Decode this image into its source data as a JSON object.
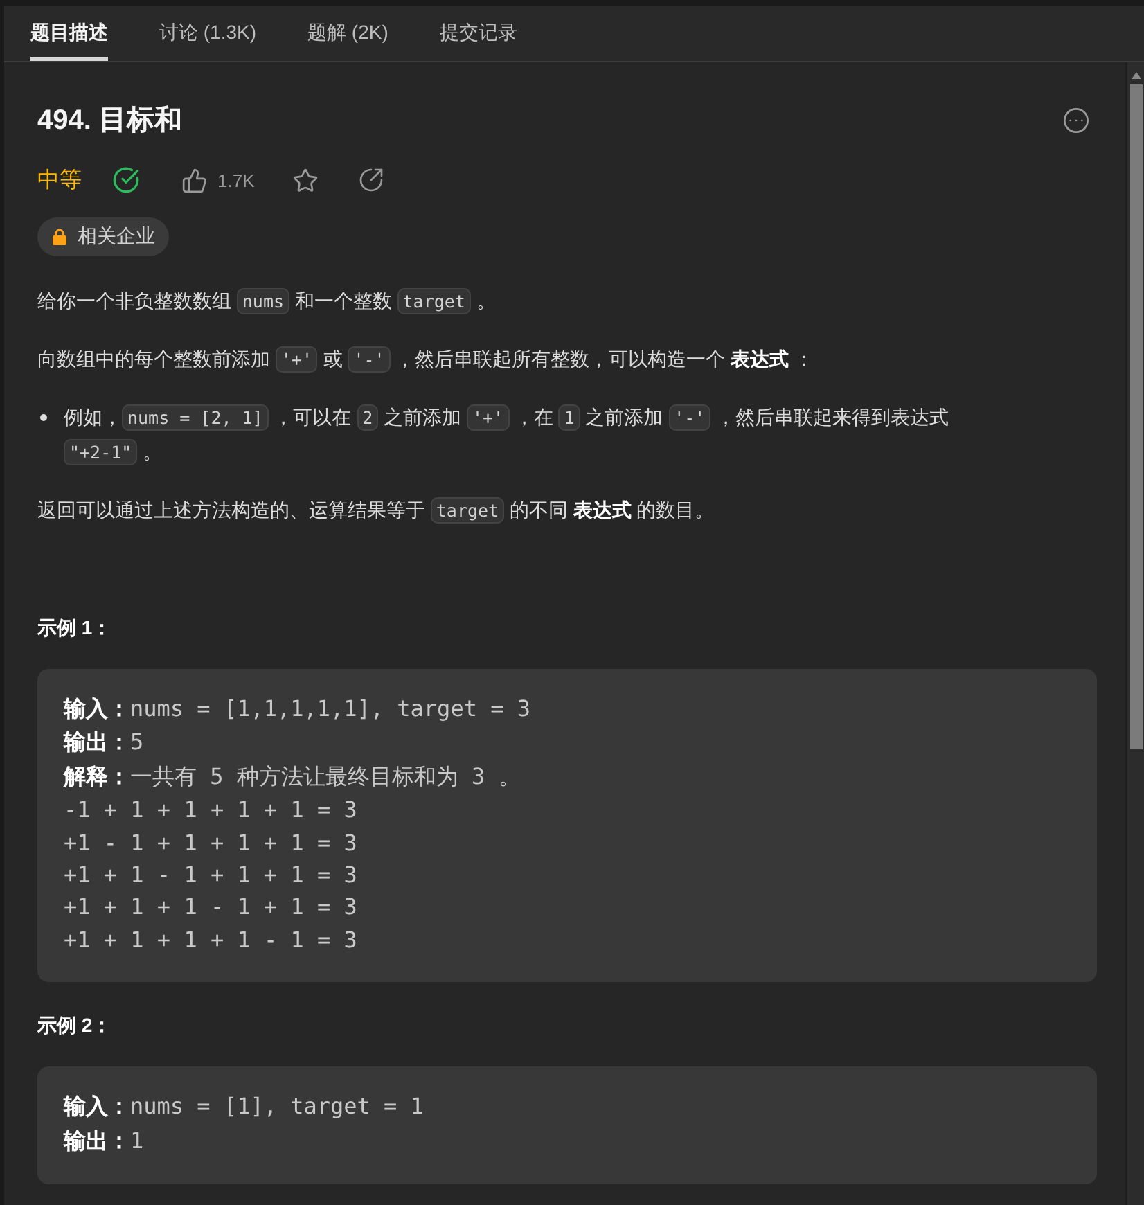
{
  "tabs": [
    {
      "label": "题目描述",
      "selected": true
    },
    {
      "label": "讨论 (1.3K)",
      "selected": false
    },
    {
      "label": "题解 (2K)",
      "selected": false
    },
    {
      "label": "提交记录",
      "selected": false
    }
  ],
  "problem": {
    "title": "494. 目标和",
    "difficulty": {
      "text": "中等",
      "color": "#ffb800"
    },
    "solved": true,
    "likes": "1.7K",
    "company_tag": "相关企业"
  },
  "description": [
    {
      "kind": "paragraph",
      "segments": [
        {
          "kind": "text",
          "text": "给你一个非负整数数组 "
        },
        {
          "kind": "code",
          "text": "nums"
        },
        {
          "kind": "text",
          "text": " 和一个整数 "
        },
        {
          "kind": "code",
          "text": "target"
        },
        {
          "kind": "text",
          "text": " 。"
        }
      ]
    },
    {
      "kind": "paragraph",
      "segments": [
        {
          "kind": "text",
          "text": "向数组中的每个整数前添加 "
        },
        {
          "kind": "code",
          "text": "'+'"
        },
        {
          "kind": "text",
          "text": " 或 "
        },
        {
          "kind": "code",
          "text": "'-'"
        },
        {
          "kind": "text",
          "text": " ，然后串联起所有整数，可以构造一个 **表达式** ："
        }
      ]
    },
    {
      "kind": "bullet",
      "segments": [
        {
          "kind": "text",
          "text": "例如，"
        },
        {
          "kind": "code",
          "text": "nums = [2, 1]"
        },
        {
          "kind": "text",
          "text": " ，可以在 "
        },
        {
          "kind": "code",
          "text": "2"
        },
        {
          "kind": "text",
          "text": " 之前添加 "
        },
        {
          "kind": "code",
          "text": "'+'"
        },
        {
          "kind": "text",
          "text": " ，在 "
        },
        {
          "kind": "code",
          "text": "1"
        },
        {
          "kind": "text",
          "text": " 之前添加 "
        },
        {
          "kind": "code",
          "text": "'-'"
        },
        {
          "kind": "text",
          "text": " ，然后串联起来得到表达式 "
        },
        {
          "kind": "code",
          "text": "\"+2-1\""
        },
        {
          "kind": "text",
          "text": " 。"
        }
      ]
    },
    {
      "kind": "paragraph",
      "segments": [
        {
          "kind": "text",
          "text": "返回可以通过上述方法构造的、运算结果等于 "
        },
        {
          "kind": "code",
          "text": "target"
        },
        {
          "kind": "text",
          "text": " 的不同 **表达式** 的数目。"
        }
      ]
    }
  ],
  "examples": [
    {
      "title": "示例 1：",
      "lines": [
        "**输入：**nums = [1,1,1,1,1], target = 3",
        "**输出：**5",
        "**解释：**一共有 5 种方法让最终目标和为 3 。",
        "-1 + 1 + 1 + 1 + 1 = 3",
        "+1 - 1 + 1 + 1 + 1 = 3",
        "+1 + 1 - 1 + 1 + 1 = 3",
        "+1 + 1 + 1 - 1 + 1 = 3",
        "+1 + 1 + 1 + 1 - 1 = 3"
      ]
    },
    {
      "title": "示例 2：",
      "lines": [
        "**输入：**nums = [1], target = 1",
        "**输出：**1"
      ]
    }
  ]
}
